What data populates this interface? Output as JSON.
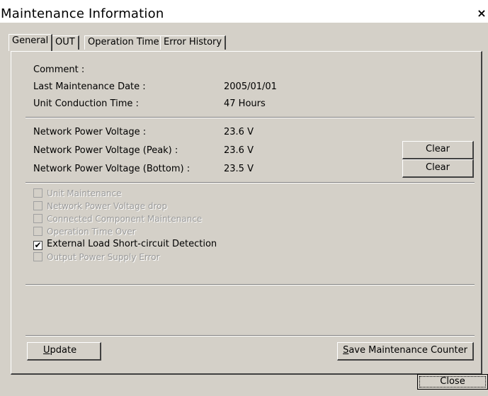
{
  "window": {
    "title": "Maintenance Information",
    "close_glyph": "×"
  },
  "tabs": [
    {
      "label": "General",
      "active": true
    },
    {
      "label": "OUT",
      "active": false
    },
    {
      "label": "Operation Time",
      "active": false
    },
    {
      "label": "Error History",
      "active": false
    }
  ],
  "info": {
    "comment_label": "Comment :",
    "last_maintenance_label": "Last Maintenance Date :",
    "last_maintenance_value": "2005/01/01",
    "conduction_label": "Unit Conduction Time :",
    "conduction_value": "47 Hours",
    "npv_label": "Network Power Voltage :",
    "npv_value": "23.6 V",
    "npv_peak_label": "Network Power Voltage (Peak) :",
    "npv_peak_value": "23.6 V",
    "npv_bottom_label": "Network Power Voltage (Bottom) :",
    "npv_bottom_value": "23.5 V",
    "clear_label": "Clear"
  },
  "checkboxes": [
    {
      "label": "Unit Maintenance",
      "checked": false,
      "enabled": false
    },
    {
      "label": "Network Power Voltage drop",
      "checked": false,
      "enabled": false
    },
    {
      "label": "Connected Component Maintenance",
      "checked": false,
      "enabled": false
    },
    {
      "label": "Operation Time Over",
      "checked": false,
      "enabled": false
    },
    {
      "label": "External Load Short-circuit Detection",
      "checked": true,
      "enabled": true
    },
    {
      "label": "Output Power Supply Error",
      "checked": false,
      "enabled": false
    }
  ],
  "buttons": {
    "update_mnemonic": "U",
    "update_rest": "pdate",
    "save_mnemonic": "S",
    "save_rest": "ave Maintenance Counter",
    "close": "Close"
  },
  "check_glyph": "✔"
}
